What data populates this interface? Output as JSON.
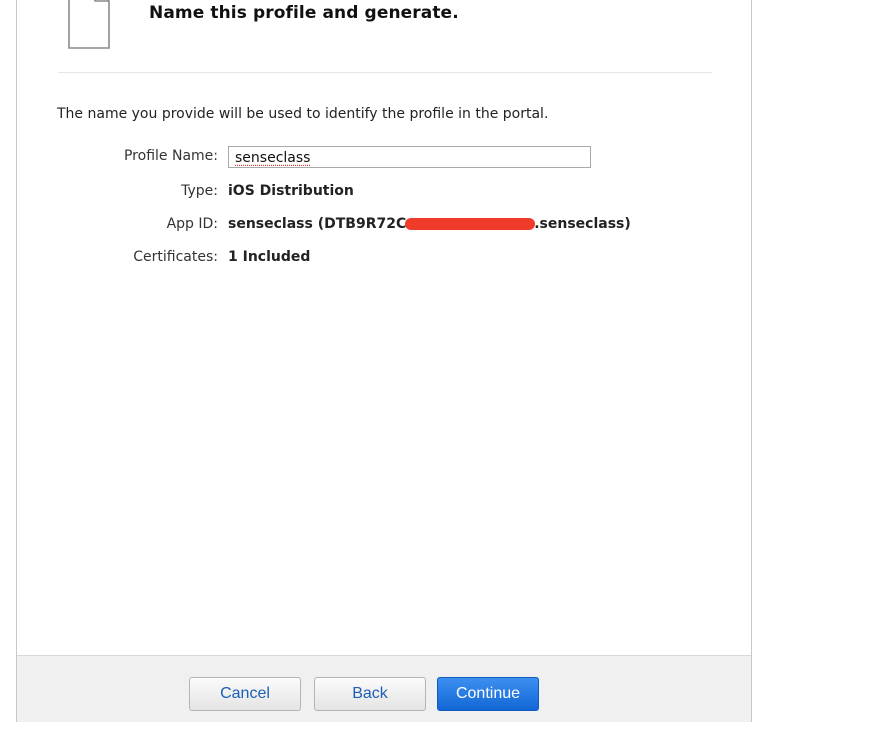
{
  "header": {
    "title": "Name this profile and generate."
  },
  "intro_text": "The name you provide will be used to identify the profile in the portal.",
  "form": {
    "profile_name": {
      "label": "Profile Name:",
      "value": "senseclass"
    },
    "type": {
      "label": "Type:",
      "value": "iOS Distribution"
    },
    "app_id": {
      "label": "App ID:",
      "value_prefix": "senseclass (DTB9R72C",
      "value_suffix": ".senseclass)"
    },
    "certificates": {
      "label": "Certificates:",
      "value": "1 Included"
    }
  },
  "footer": {
    "cancel_label": "Cancel",
    "back_label": "Back",
    "continue_label": "Continue"
  },
  "colors": {
    "primary_button": "#1a73e0",
    "secondary_text": "#1d5fb5",
    "redaction": "#f03a2a"
  },
  "icons": {
    "document": "document-icon"
  }
}
